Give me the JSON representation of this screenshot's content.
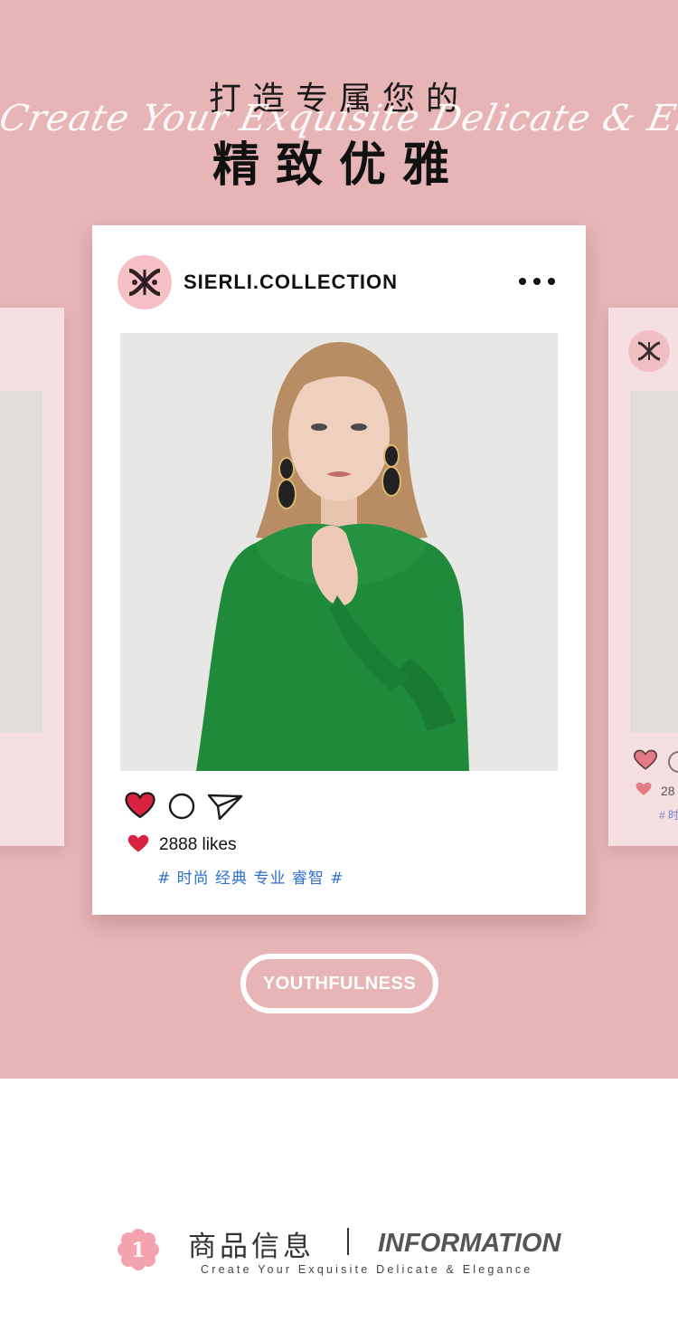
{
  "header": {
    "title_line1": "打造专属您的",
    "script_text": "Create Your Exquisite Delicate & Elegance",
    "title_line2": "精致优雅"
  },
  "post": {
    "brand": "SIERLI.COLLECTION",
    "likes": "2888 likes",
    "tags": "# 时尚 经典 专业 睿智 #"
  },
  "side_card": {
    "likes_partial": "28",
    "tag_partial": "# 时"
  },
  "cta": {
    "label": "YOUTHFULNESS"
  },
  "info": {
    "number": "1",
    "title_cn": "商品信息",
    "title_en": "INFORMATION",
    "subtitle": "Create Your Exquisite Delicate & Elegance"
  },
  "colors": {
    "hero_bg": "#e8b5b6",
    "heart_red": "#d7233f",
    "tag_blue": "#2f6fd0",
    "blouse_green": "#1f8a3a"
  },
  "icons": [
    "heart-icon",
    "comment-icon",
    "share-icon",
    "more-icon",
    "brand-logo"
  ]
}
